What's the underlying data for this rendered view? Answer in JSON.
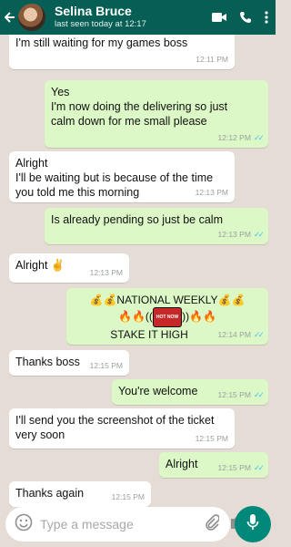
{
  "header": {
    "contact_name": "Selina Bruce",
    "status": "last seen today at 12:17"
  },
  "messages": [
    {
      "dir": "in",
      "lines": [
        "I'm still waiting for my games boss"
      ],
      "time": "12:11 PM"
    },
    {
      "dir": "out",
      "lines": [
        "Yes",
        "I'm now doing the delivering so just",
        "calm down for me small please"
      ],
      "time": "12:12 PM"
    },
    {
      "dir": "in",
      "lines": [
        "Alright",
        "I'll be waiting but is because of the time",
        "you told me this morning"
      ],
      "time": "12:13 PM"
    },
    {
      "dir": "out",
      "lines": [
        "Is already pending so just be calm"
      ],
      "time": "12:13 PM"
    },
    {
      "dir": "in",
      "lines": [
        "Alright ✌"
      ],
      "time": "12:13 PM"
    },
    {
      "dir": "out",
      "lines": [
        "💰💰NATIONAL WEEKLY💰💰",
        "🔥🔥((",
        "))🔥🔥",
        "STAKE IT HIGH"
      ],
      "badge": "HOT NOW",
      "time": "12:14 PM"
    },
    {
      "dir": "in",
      "lines": [
        "Thanks boss"
      ],
      "time": "12:15 PM"
    },
    {
      "dir": "out",
      "lines": [
        "You're welcome"
      ],
      "time": "12:15 PM"
    },
    {
      "dir": "in",
      "lines": [
        "I'll send you the screenshot of the ticket",
        "very soon"
      ],
      "time": "12:15 PM"
    },
    {
      "dir": "out",
      "lines": [
        "Alright"
      ],
      "time": "12:15 PM"
    },
    {
      "dir": "in",
      "lines": [
        "Thanks again"
      ],
      "time": "12:15 PM"
    }
  ],
  "input": {
    "placeholder": "Type a message"
  },
  "icons": {
    "back": "arrow-left",
    "video": "video-camera",
    "call": "phone",
    "menu": "vertical-ellipsis",
    "emoji": "smiley",
    "attach": "paperclip",
    "camera": "camera",
    "mic": "microphone"
  },
  "colors": {
    "header": "#075e54",
    "background": "#e5ddd5",
    "outgoing": "#dcf8c6",
    "incoming": "#ffffff",
    "ticks": "#4fc3f7",
    "mic": "#00897b"
  }
}
